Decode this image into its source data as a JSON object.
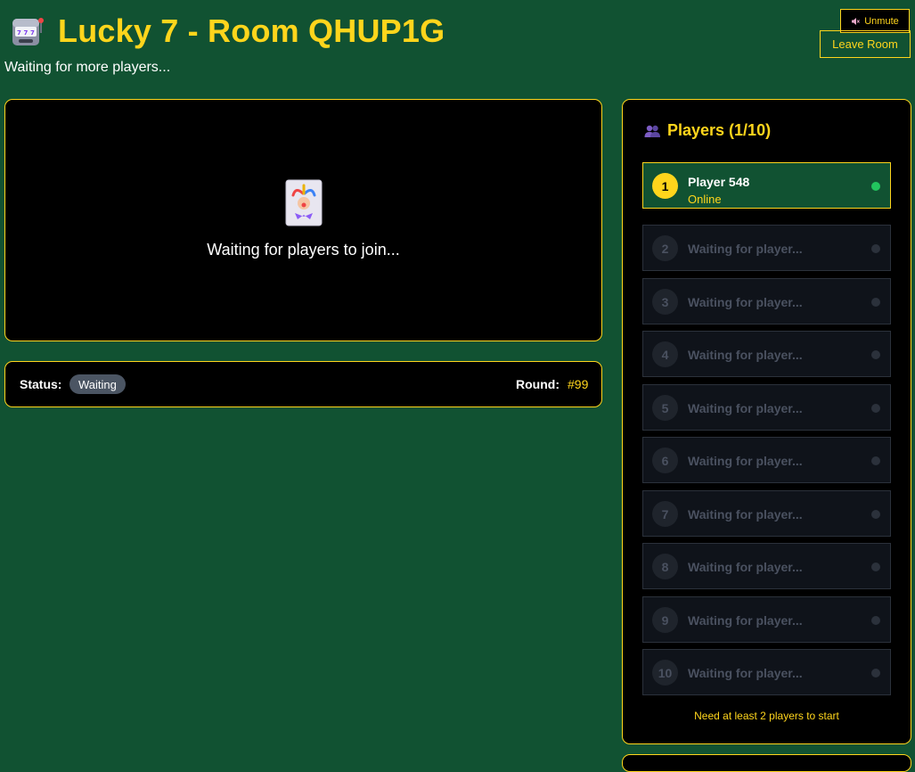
{
  "header": {
    "title": "Lucky 7 - Room QHUP1G",
    "subtitle": "Waiting for more players...",
    "title_icon": "slot-machine-icon"
  },
  "controls": {
    "unmute_label": "Unmute",
    "unmute_icon": "speaker-muted-icon",
    "leave_label": "Leave Room"
  },
  "game": {
    "waiting_text": "Waiting for players to join...",
    "card_icon": "joker-card-icon"
  },
  "status": {
    "label": "Status:",
    "value": "Waiting",
    "round_label": "Round:",
    "round_value": "#99"
  },
  "players": {
    "title": "Players (1/10)",
    "icon": "people-icon",
    "slots": [
      {
        "number": "1",
        "name": "Player 548",
        "status": "Online",
        "active": true
      },
      {
        "number": "2",
        "name": "Waiting for player...",
        "active": false
      },
      {
        "number": "3",
        "name": "Waiting for player...",
        "active": false
      },
      {
        "number": "4",
        "name": "Waiting for player...",
        "active": false
      },
      {
        "number": "5",
        "name": "Waiting for player...",
        "active": false
      },
      {
        "number": "6",
        "name": "Waiting for player...",
        "active": false
      },
      {
        "number": "7",
        "name": "Waiting for player...",
        "active": false
      },
      {
        "number": "8",
        "name": "Waiting for player...",
        "active": false
      },
      {
        "number": "9",
        "name": "Waiting for player...",
        "active": false
      },
      {
        "number": "10",
        "name": "Waiting for player...",
        "active": false
      }
    ],
    "footer": "Need at least 2 players to start"
  },
  "colors": {
    "background": "#115232",
    "accent": "#ffd51c",
    "online": "#22c55e",
    "badge": "#4b5563"
  }
}
